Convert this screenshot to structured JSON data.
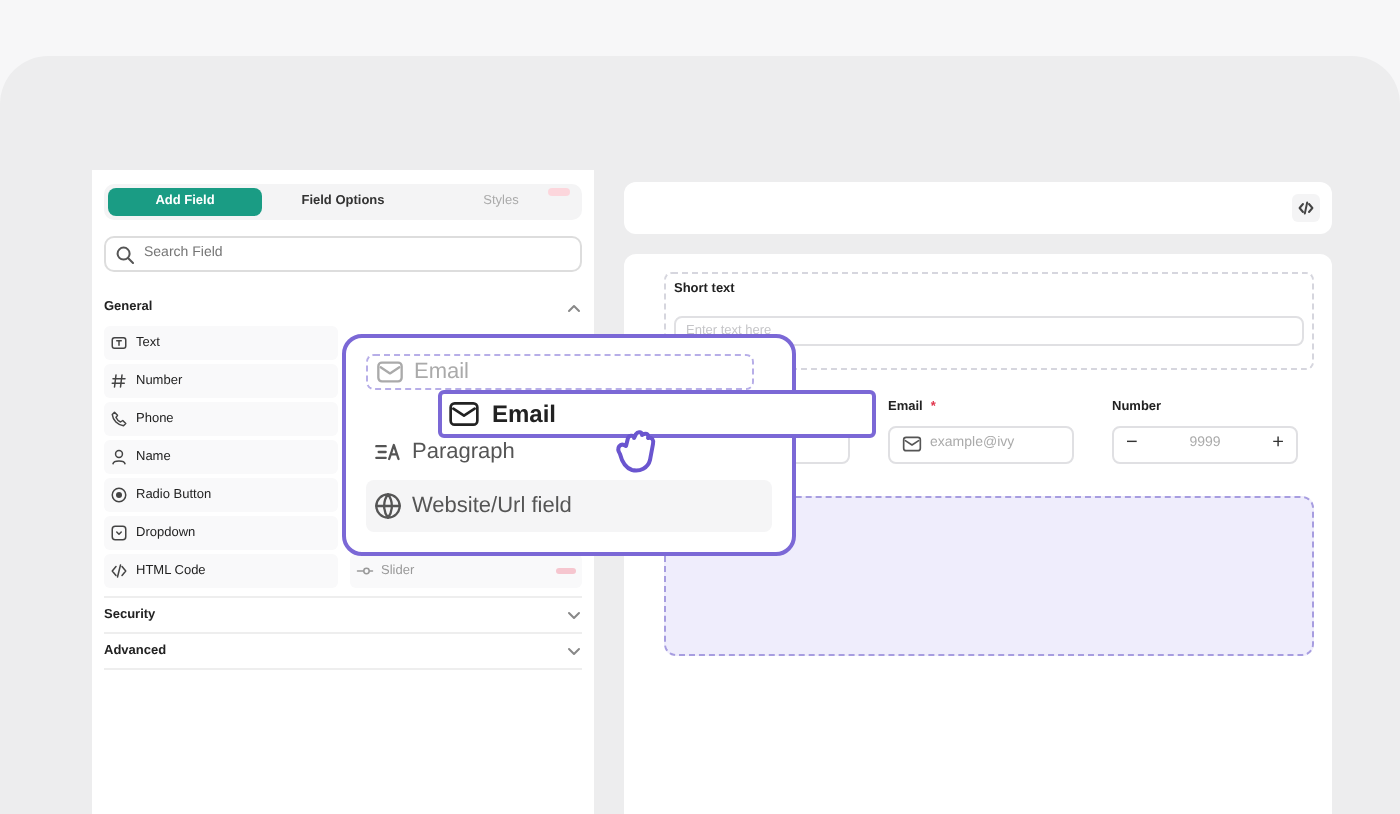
{
  "tabs": [
    {
      "label": "Add Field",
      "selected": true,
      "disabled": false,
      "new_badge": false
    },
    {
      "label": "Field Options",
      "selected": false,
      "disabled": false,
      "new_badge": false
    },
    {
      "label": "Styles",
      "selected": false,
      "disabled": true,
      "new_badge": true
    }
  ],
  "search": {
    "placeholder": "Search Field"
  },
  "sections": [
    {
      "title": "General",
      "expanded": true,
      "left_column": [
        {
          "label": "Text",
          "kind": "text"
        },
        {
          "label": "Number",
          "kind": "number"
        },
        {
          "label": "Phone",
          "kind": "phone"
        },
        {
          "label": "Name",
          "kind": "name"
        },
        {
          "label": "Radio Button",
          "kind": "radio"
        },
        {
          "label": "Dropdown",
          "kind": "dropdown"
        },
        {
          "label": "HTML Code",
          "kind": "code"
        }
      ],
      "right_column": [
        {
          "label": "Slider",
          "kind": "slider",
          "new_badge": true
        }
      ]
    },
    {
      "title": "Security",
      "expanded": false
    },
    {
      "title": "Advanced",
      "expanded": false
    }
  ],
  "drag_menu": {
    "items": [
      {
        "label": "Email",
        "kind": "email",
        "ghost": true,
        "highlighted": false
      },
      {
        "label": "Paragraph",
        "kind": "paragraph",
        "ghost": false,
        "highlighted": false
      },
      {
        "label": "Website/Url field",
        "kind": "url",
        "ghost": false,
        "highlighted": true
      }
    ]
  },
  "dragged_item": {
    "label": "Email",
    "kind": "email"
  },
  "form": {
    "short_text": {
      "label": "Short text",
      "placeholder": "Enter text here"
    },
    "fields": [
      {
        "kind": "text"
      },
      {
        "kind": "email",
        "label": "Email",
        "required_mark": "*",
        "placeholder": "example@ivy"
      },
      {
        "kind": "number",
        "label": "Number",
        "placeholder": "9999",
        "decrement": "−",
        "increment": "+"
      }
    ],
    "drop_zone": {
      "highlighted": true
    }
  }
}
